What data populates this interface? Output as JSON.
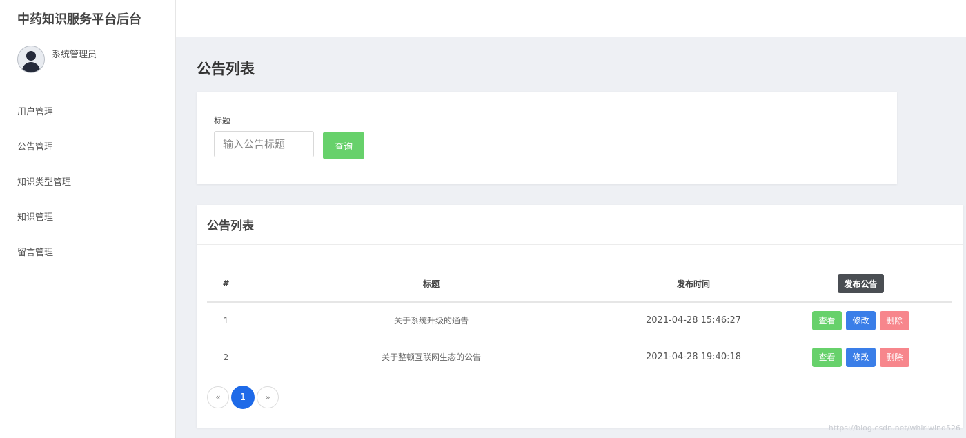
{
  "app": {
    "title": "中药知识服务平台后台"
  },
  "user": {
    "name": "系统管理员"
  },
  "sidebar": {
    "items": [
      {
        "label": "用户管理"
      },
      {
        "label": "公告管理"
      },
      {
        "label": "知识类型管理"
      },
      {
        "label": "知识管理"
      },
      {
        "label": "留言管理"
      }
    ]
  },
  "page": {
    "title": "公告列表"
  },
  "search": {
    "label": "标题",
    "placeholder": "输入公告标题",
    "button": "查询"
  },
  "list": {
    "title": "公告列表",
    "headers": {
      "id": "#",
      "title": "标题",
      "time": "发布时间"
    },
    "publish_button": "发布公告",
    "rows": [
      {
        "id": "1",
        "title": "关于系统升级的通告",
        "time": "2021-04-28 15:46:27",
        "view": "查看",
        "edit": "修改",
        "delete": "删除"
      },
      {
        "id": "2",
        "title": "关于整顿互联网生态的公告",
        "time": "2021-04-28 19:40:18",
        "view": "查看",
        "edit": "修改",
        "delete": "删除"
      }
    ]
  },
  "pagination": {
    "prev": "«",
    "current": "1",
    "next": "»"
  },
  "watermark": "https://blog.csdn.net/whirlwind526",
  "colors": {
    "success": "#67d16b",
    "primary": "#3a7ee8",
    "danger": "#f7868c",
    "dark": "#4a4e53",
    "page_active": "#1e6ae8"
  }
}
